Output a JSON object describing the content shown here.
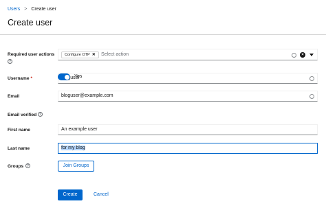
{
  "breadcrumb": {
    "parent": "Users",
    "separator": ">",
    "current": "Create user"
  },
  "page_title": "Create user",
  "form": {
    "required_actions": {
      "label": "Required user actions",
      "chip_label": "Configure OTP",
      "chip_remove": "✕",
      "placeholder": "Select action"
    },
    "username": {
      "label": "Username",
      "required_marker": "*",
      "value": "bloguser"
    },
    "email": {
      "label": "Email",
      "value": "bloguser@example.com"
    },
    "email_verified": {
      "label": "Email verified",
      "toggle_label": "Yes",
      "on": true
    },
    "first_name": {
      "label": "First name",
      "value": "An example user"
    },
    "last_name": {
      "label": "Last name",
      "value": "for my blog"
    },
    "groups": {
      "label": "Groups",
      "button": "Join Groups"
    }
  },
  "actions": {
    "create": "Create",
    "cancel": "Cancel"
  },
  "colors": {
    "accent": "#0066cc",
    "required": "#c9190b"
  },
  "icons": {
    "help": "help-icon",
    "clear": "clear-icon",
    "caret": "caret-down-icon",
    "remove": "close-icon"
  }
}
